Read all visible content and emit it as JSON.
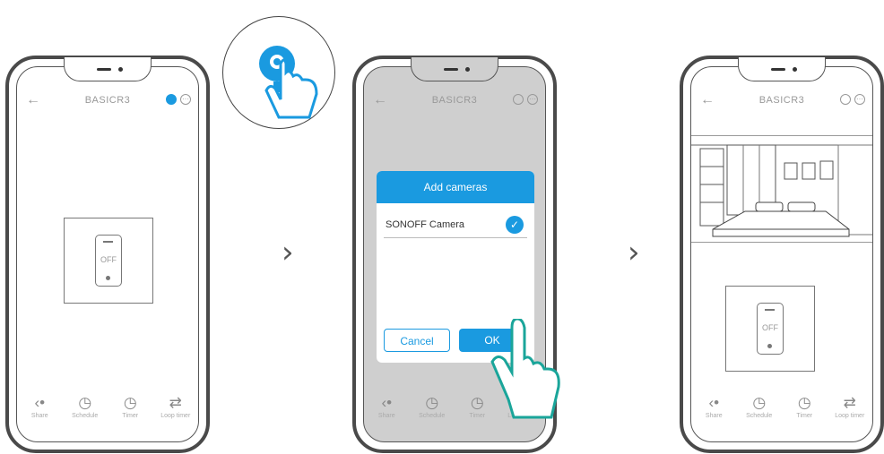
{
  "colors": {
    "accent": "#1a9ae0"
  },
  "common": {
    "screen_title": "BASICR3",
    "switch_state": "OFF",
    "bottom_items": [
      {
        "label": "Share",
        "icon": "share-icon"
      },
      {
        "label": "Schedule",
        "icon": "schedule-icon"
      },
      {
        "label": "Timer",
        "icon": "timer-icon"
      },
      {
        "label": "Loop timer",
        "icon": "loop-timer-icon"
      }
    ]
  },
  "dialog": {
    "title": "Add cameras",
    "item_label": "SONOFF Camera",
    "item_checked": true,
    "cancel_label": "Cancel",
    "ok_label": "OK"
  }
}
